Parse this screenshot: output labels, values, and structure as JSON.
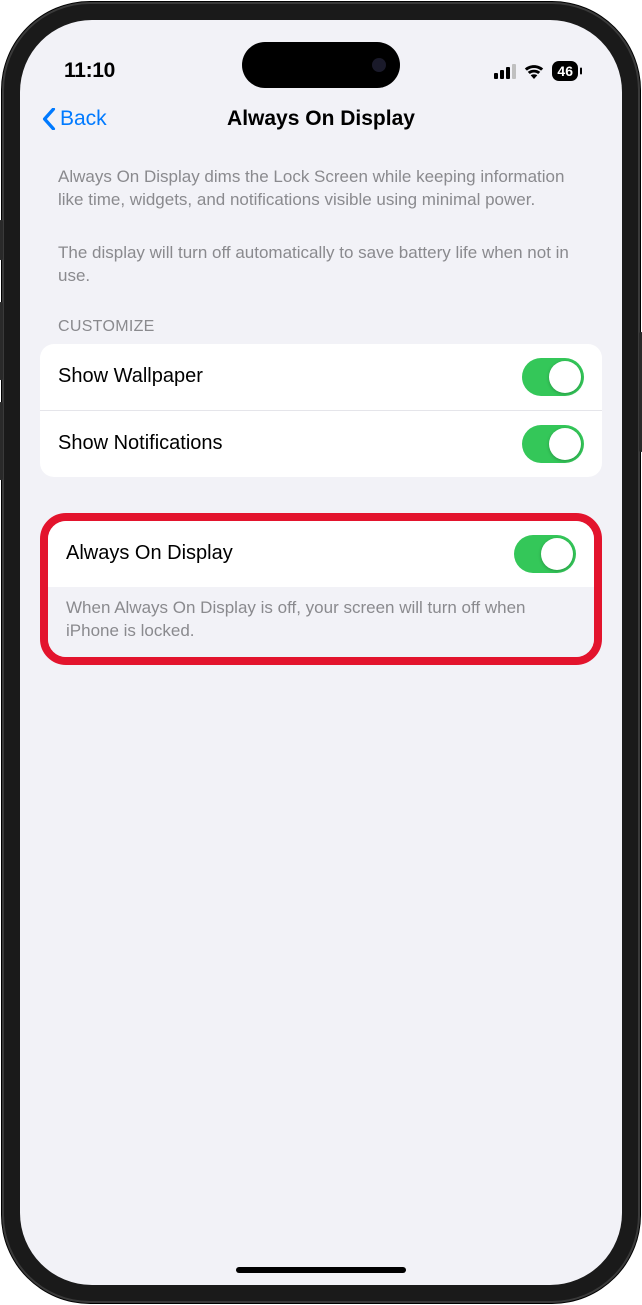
{
  "status": {
    "time": "11:10",
    "battery": "46"
  },
  "nav": {
    "back": "Back",
    "title": "Always On Display"
  },
  "desc1": "Always On Display dims the Lock Screen while keeping information like time, widgets, and notifications visible using minimal power.",
  "desc2": "The display will turn off automatically to save battery life when not in use.",
  "customize": {
    "header": "CUSTOMIZE",
    "rows": [
      {
        "label": "Show Wallpaper"
      },
      {
        "label": "Show Notifications"
      }
    ]
  },
  "main": {
    "row": {
      "label": "Always On Display"
    },
    "footnote": "When Always On Display is off, your screen will turn off when iPhone is locked."
  }
}
